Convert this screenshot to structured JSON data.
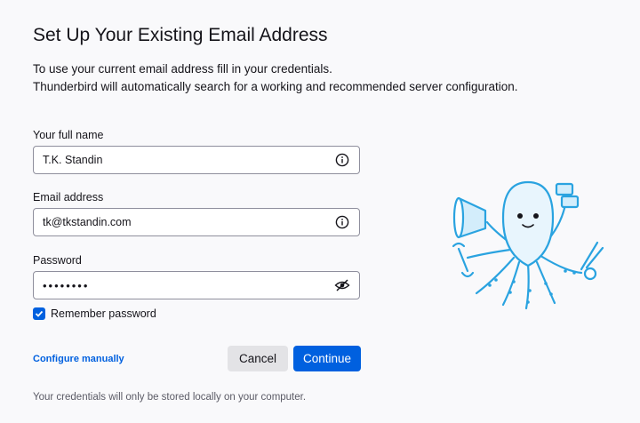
{
  "header": {
    "title": "Set Up Your Existing Email Address",
    "intro_line1": "To use your current email address fill in your credentials.",
    "intro_line2": "Thunderbird will automatically search for a working and recommended server configuration."
  },
  "form": {
    "full_name": {
      "label": "Your full name",
      "value": "T.K. Standin",
      "icon": "info-icon"
    },
    "email": {
      "label": "Email address",
      "value": "tk@tkstandin.com",
      "icon": "info-icon"
    },
    "password": {
      "label": "Password",
      "value": "••••••••",
      "icon": "eye-slash-icon"
    },
    "remember": {
      "label": "Remember password",
      "checked": true
    }
  },
  "actions": {
    "configure_manually": "Configure manually",
    "cancel": "Cancel",
    "continue": "Continue"
  },
  "footer": {
    "note": "Your credentials will only be stored locally on your computer."
  },
  "colors": {
    "accent": "#0060df",
    "mascot": "#2aa3e0"
  }
}
